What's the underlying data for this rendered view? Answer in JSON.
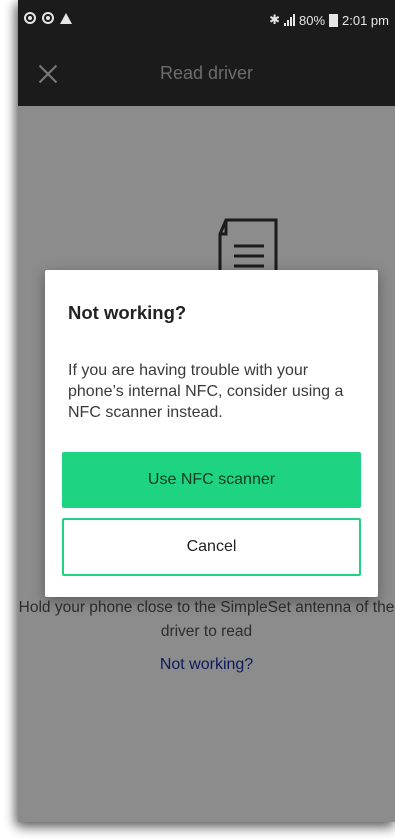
{
  "status_bar": {
    "left_icons": [
      "notification-icon",
      "notification-icon",
      "warning-icon"
    ],
    "bluetooth_glyph": "✱",
    "battery_percent": "80%",
    "time": "2:01 pm"
  },
  "app_bar": {
    "title": "Read driver",
    "close_icon": "close-icon"
  },
  "background": {
    "instruction": "Hold your phone close to the SimpleSet antenna of the driver to read",
    "link": "Not working?"
  },
  "dialog": {
    "title": "Not working?",
    "body": "If you are having trouble with your phone’s internal NFC, consider using a NFC scanner instead.",
    "primary_button": "Use NFC scanner",
    "secondary_button": "Cancel"
  },
  "colors": {
    "accent": "#1ed381",
    "app_bar": "#1b1b1b",
    "scrim": "#8c8c8c",
    "link": "#0d1a5a"
  }
}
